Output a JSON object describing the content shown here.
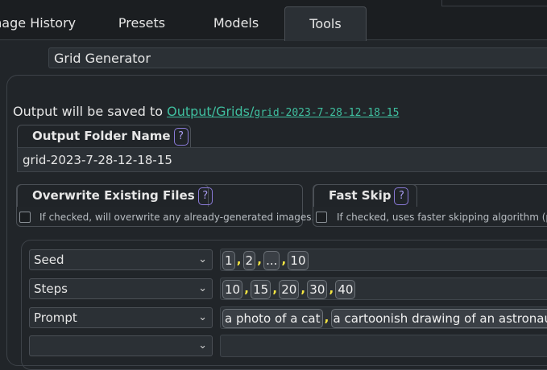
{
  "tabs": [
    "Image History",
    "Presets",
    "Models",
    "Tools"
  ],
  "tools_dropdown": {
    "selected": "Grid Generator"
  },
  "output": {
    "prefix": "Output will be saved to",
    "link_folder": "Output/Grids/",
    "link_name": "grid-2023-7-28-12-18-15"
  },
  "folder": {
    "label": "Output Folder Name",
    "help": "?",
    "value": "grid-2023-7-28-12-18-15"
  },
  "overwrite": {
    "label": "Overwrite Existing Files",
    "help": "?",
    "hint": "If checked, will overwrite any already-generated images."
  },
  "fastskip": {
    "label": "Fast Skip",
    "help": "?",
    "hint": "If checked, uses faster skipping algorithm (pr"
  },
  "axes": [
    {
      "param": "Seed",
      "values": [
        "1",
        "2",
        "...",
        "10"
      ]
    },
    {
      "param": "Steps",
      "values": [
        "10",
        "15",
        "20",
        "30",
        "40"
      ]
    },
    {
      "param": "Prompt",
      "values": [
        "a photo of a cat",
        "a cartoonish drawing of an astronaut"
      ]
    },
    {
      "param": "",
      "values": []
    }
  ],
  "icons": {
    "dropdown": "chevron-down-icon",
    "help": "help-icon"
  }
}
